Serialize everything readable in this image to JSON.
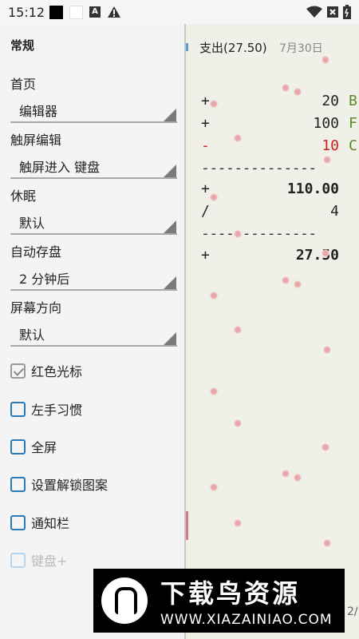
{
  "status_bar": {
    "time": "15:12",
    "icons": [
      "black-square-icon",
      "white-square-icon",
      "a-icon",
      "warning-icon",
      "wifi-icon",
      "close-box-icon",
      "battery-icon"
    ]
  },
  "sidebar": {
    "section_title": "常规",
    "prefs": [
      {
        "label": "首页",
        "value": "编辑器"
      },
      {
        "label": "触屏编辑",
        "value": "触屏进入 键盘"
      },
      {
        "label": "休眠",
        "value": "默认"
      },
      {
        "label": "自动存盘",
        "value": "2 分钟后"
      },
      {
        "label": "屏幕方向",
        "value": "默认"
      }
    ],
    "checkboxes": [
      {
        "label": "红色光标",
        "checked": true,
        "enabled": true
      },
      {
        "label": "左手习惯",
        "checked": false,
        "enabled": true
      },
      {
        "label": "全屏",
        "checked": false,
        "enabled": true
      },
      {
        "label": "设置解锁图案",
        "checked": false,
        "enabled": true
      },
      {
        "label": "通知栏",
        "checked": false,
        "enabled": true
      },
      {
        "label": "键盘+",
        "checked": false,
        "enabled": false
      }
    ]
  },
  "editor": {
    "title": "支出(27.50)",
    "date": "7月30日",
    "lines": [
      {
        "op": "+",
        "amount": "20",
        "tag": "B",
        "color": "#222222",
        "tag_color": "#5a8a2a"
      },
      {
        "op": "+",
        "amount": "100",
        "tag": "F",
        "color": "#222222",
        "tag_color": "#5a8a2a"
      },
      {
        "op": "-",
        "amount": "10",
        "tag": "C",
        "color": "#cc2222",
        "tag_color": "#5a8a2a"
      }
    ],
    "separator": "--------------",
    "subtotal": {
      "op": "+",
      "amount": "110.00"
    },
    "divisor": {
      "op": "/",
      "amount": "4"
    },
    "result": {
      "op": "+",
      "amount": "27.50"
    },
    "page_indicator": "2/"
  },
  "watermark": {
    "name": "下载鸟资源",
    "url": "WWW.XIAZAINIAO.COM"
  }
}
